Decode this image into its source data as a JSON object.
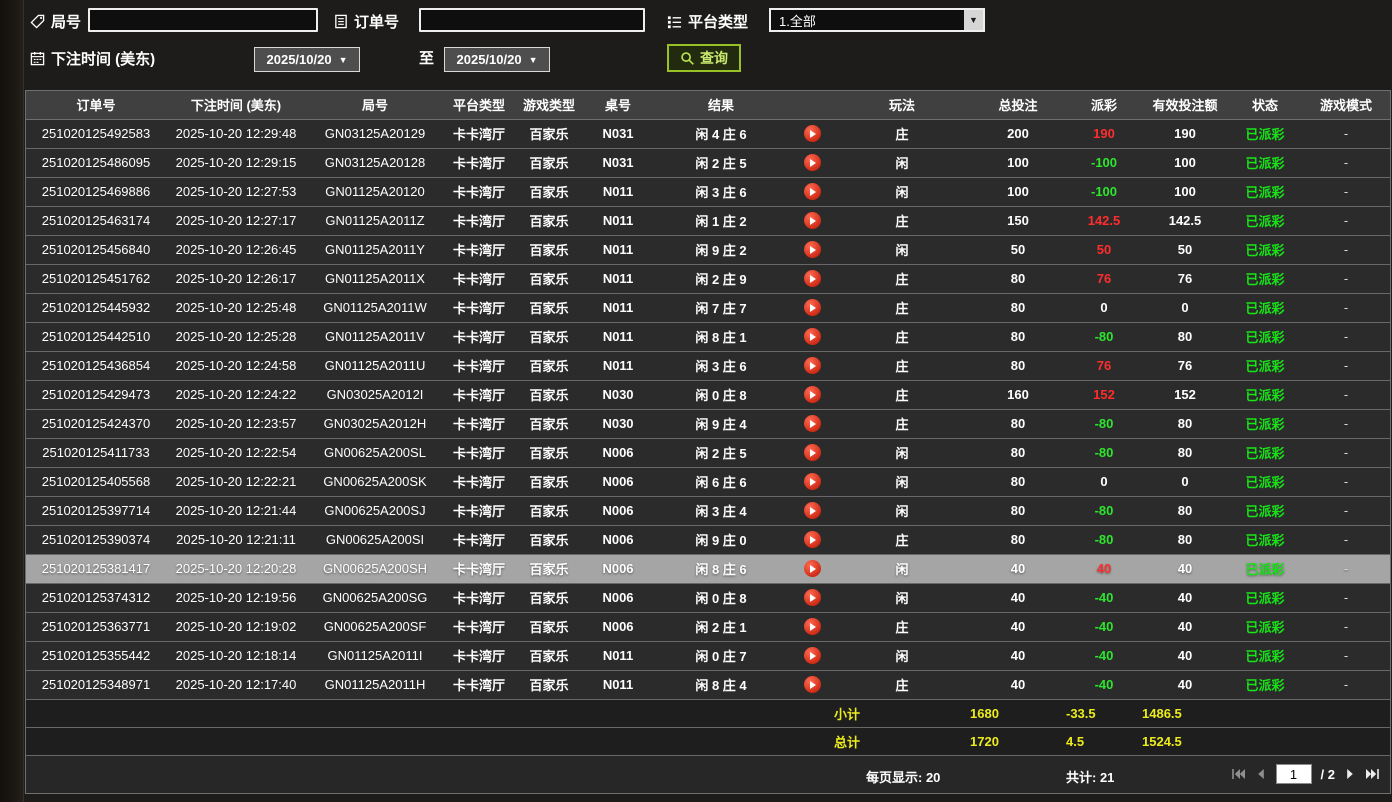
{
  "filters": {
    "round_label": "局号",
    "round_value": "",
    "order_label": "订单号",
    "order_value": "",
    "platform_label": "平台类型",
    "platform_value": "1.全部",
    "bet_time_label": "下注时间 (美东)",
    "date_from": "2025/10/20",
    "to_label": "至",
    "date_to": "2025/10/20",
    "query_label": "查询"
  },
  "colors": {
    "payout_positive": "#ff2d2d",
    "payout_negative": "#2ee52e",
    "status_green": "#17e317",
    "query_green": "#96c225",
    "footer_yellow": "#ecec1d"
  },
  "table": {
    "headers": [
      "订单号",
      "下注时间 (美东)",
      "局号",
      "平台类型",
      "游戏类型",
      "桌号",
      "结果",
      "",
      "玩法",
      "总投注",
      "派彩",
      "有效投注额",
      "状态",
      "游戏模式"
    ],
    "rows": [
      {
        "order_id": "251020125492583",
        "time": "2025-10-20 12:29:48",
        "round": "GN03125A20129",
        "platform": "卡卡湾厅",
        "game": "百家乐",
        "table_no": "N031",
        "result": "闲 4 庄 6",
        "play": "庄",
        "total_bet": "200",
        "payout": "190",
        "payout_sign": "pos",
        "valid_bet": "190",
        "status": "已派彩",
        "mode": "-",
        "selected": false
      },
      {
        "order_id": "251020125486095",
        "time": "2025-10-20 12:29:15",
        "round": "GN03125A20128",
        "platform": "卡卡湾厅",
        "game": "百家乐",
        "table_no": "N031",
        "result": "闲 2 庄 5",
        "play": "闲",
        "total_bet": "100",
        "payout": "-100",
        "payout_sign": "neg",
        "valid_bet": "100",
        "status": "已派彩",
        "mode": "-",
        "selected": false
      },
      {
        "order_id": "251020125469886",
        "time": "2025-10-20 12:27:53",
        "round": "GN01125A20120",
        "platform": "卡卡湾厅",
        "game": "百家乐",
        "table_no": "N011",
        "result": "闲 3 庄 6",
        "play": "闲",
        "total_bet": "100",
        "payout": "-100",
        "payout_sign": "neg",
        "valid_bet": "100",
        "status": "已派彩",
        "mode": "-",
        "selected": false
      },
      {
        "order_id": "251020125463174",
        "time": "2025-10-20 12:27:17",
        "round": "GN01125A2011Z",
        "platform": "卡卡湾厅",
        "game": "百家乐",
        "table_no": "N011",
        "result": "闲 1 庄 2",
        "play": "庄",
        "total_bet": "150",
        "payout": "142.5",
        "payout_sign": "pos",
        "valid_bet": "142.5",
        "status": "已派彩",
        "mode": "-",
        "selected": false
      },
      {
        "order_id": "251020125456840",
        "time": "2025-10-20 12:26:45",
        "round": "GN01125A2011Y",
        "platform": "卡卡湾厅",
        "game": "百家乐",
        "table_no": "N011",
        "result": "闲 9 庄 2",
        "play": "闲",
        "total_bet": "50",
        "payout": "50",
        "payout_sign": "pos",
        "valid_bet": "50",
        "status": "已派彩",
        "mode": "-",
        "selected": false
      },
      {
        "order_id": "251020125451762",
        "time": "2025-10-20 12:26:17",
        "round": "GN01125A2011X",
        "platform": "卡卡湾厅",
        "game": "百家乐",
        "table_no": "N011",
        "result": "闲 2 庄 9",
        "play": "庄",
        "total_bet": "80",
        "payout": "76",
        "payout_sign": "pos",
        "valid_bet": "76",
        "status": "已派彩",
        "mode": "-",
        "selected": false
      },
      {
        "order_id": "251020125445932",
        "time": "2025-10-20 12:25:48",
        "round": "GN01125A2011W",
        "platform": "卡卡湾厅",
        "game": "百家乐",
        "table_no": "N011",
        "result": "闲 7 庄 7",
        "play": "庄",
        "total_bet": "80",
        "payout": "0",
        "payout_sign": "zero",
        "valid_bet": "0",
        "status": "已派彩",
        "mode": "-",
        "selected": false
      },
      {
        "order_id": "251020125442510",
        "time": "2025-10-20 12:25:28",
        "round": "GN01125A2011V",
        "platform": "卡卡湾厅",
        "game": "百家乐",
        "table_no": "N011",
        "result": "闲 8 庄 1",
        "play": "庄",
        "total_bet": "80",
        "payout": "-80",
        "payout_sign": "neg",
        "valid_bet": "80",
        "status": "已派彩",
        "mode": "-",
        "selected": false
      },
      {
        "order_id": "251020125436854",
        "time": "2025-10-20 12:24:58",
        "round": "GN01125A2011U",
        "platform": "卡卡湾厅",
        "game": "百家乐",
        "table_no": "N011",
        "result": "闲 3 庄 6",
        "play": "庄",
        "total_bet": "80",
        "payout": "76",
        "payout_sign": "pos",
        "valid_bet": "76",
        "status": "已派彩",
        "mode": "-",
        "selected": false
      },
      {
        "order_id": "251020125429473",
        "time": "2025-10-20 12:24:22",
        "round": "GN03025A2012I",
        "platform": "卡卡湾厅",
        "game": "百家乐",
        "table_no": "N030",
        "result": "闲 0 庄 8",
        "play": "庄",
        "total_bet": "160",
        "payout": "152",
        "payout_sign": "pos",
        "valid_bet": "152",
        "status": "已派彩",
        "mode": "-",
        "selected": false
      },
      {
        "order_id": "251020125424370",
        "time": "2025-10-20 12:23:57",
        "round": "GN03025A2012H",
        "platform": "卡卡湾厅",
        "game": "百家乐",
        "table_no": "N030",
        "result": "闲 9 庄 4",
        "play": "庄",
        "total_bet": "80",
        "payout": "-80",
        "payout_sign": "neg",
        "valid_bet": "80",
        "status": "已派彩",
        "mode": "-",
        "selected": false
      },
      {
        "order_id": "251020125411733",
        "time": "2025-10-20 12:22:54",
        "round": "GN00625A200SL",
        "platform": "卡卡湾厅",
        "game": "百家乐",
        "table_no": "N006",
        "result": "闲 2 庄 5",
        "play": "闲",
        "total_bet": "80",
        "payout": "-80",
        "payout_sign": "neg",
        "valid_bet": "80",
        "status": "已派彩",
        "mode": "-",
        "selected": false
      },
      {
        "order_id": "251020125405568",
        "time": "2025-10-20 12:22:21",
        "round": "GN00625A200SK",
        "platform": "卡卡湾厅",
        "game": "百家乐",
        "table_no": "N006",
        "result": "闲 6 庄 6",
        "play": "闲",
        "total_bet": "80",
        "payout": "0",
        "payout_sign": "zero",
        "valid_bet": "0",
        "status": "已派彩",
        "mode": "-",
        "selected": false
      },
      {
        "order_id": "251020125397714",
        "time": "2025-10-20 12:21:44",
        "round": "GN00625A200SJ",
        "platform": "卡卡湾厅",
        "game": "百家乐",
        "table_no": "N006",
        "result": "闲 3 庄 4",
        "play": "闲",
        "total_bet": "80",
        "payout": "-80",
        "payout_sign": "neg",
        "valid_bet": "80",
        "status": "已派彩",
        "mode": "-",
        "selected": false
      },
      {
        "order_id": "251020125390374",
        "time": "2025-10-20 12:21:11",
        "round": "GN00625A200SI",
        "platform": "卡卡湾厅",
        "game": "百家乐",
        "table_no": "N006",
        "result": "闲 9 庄 0",
        "play": "庄",
        "total_bet": "80",
        "payout": "-80",
        "payout_sign": "neg",
        "valid_bet": "80",
        "status": "已派彩",
        "mode": "-",
        "selected": false
      },
      {
        "order_id": "251020125381417",
        "time": "2025-10-20 12:20:28",
        "round": "GN00625A200SH",
        "platform": "卡卡湾厅",
        "game": "百家乐",
        "table_no": "N006",
        "result": "闲 8 庄 6",
        "play": "闲",
        "total_bet": "40",
        "payout": "40",
        "payout_sign": "pos",
        "valid_bet": "40",
        "status": "已派彩",
        "mode": "-",
        "selected": true
      },
      {
        "order_id": "251020125374312",
        "time": "2025-10-20 12:19:56",
        "round": "GN00625A200SG",
        "platform": "卡卡湾厅",
        "game": "百家乐",
        "table_no": "N006",
        "result": "闲 0 庄 8",
        "play": "闲",
        "total_bet": "40",
        "payout": "-40",
        "payout_sign": "neg",
        "valid_bet": "40",
        "status": "已派彩",
        "mode": "-",
        "selected": false
      },
      {
        "order_id": "251020125363771",
        "time": "2025-10-20 12:19:02",
        "round": "GN00625A200SF",
        "platform": "卡卡湾厅",
        "game": "百家乐",
        "table_no": "N006",
        "result": "闲 2 庄 1",
        "play": "庄",
        "total_bet": "40",
        "payout": "-40",
        "payout_sign": "neg",
        "valid_bet": "40",
        "status": "已派彩",
        "mode": "-",
        "selected": false
      },
      {
        "order_id": "251020125355442",
        "time": "2025-10-20 12:18:14",
        "round": "GN01125A2011I",
        "platform": "卡卡湾厅",
        "game": "百家乐",
        "table_no": "N011",
        "result": "闲 0 庄 7",
        "play": "闲",
        "total_bet": "40",
        "payout": "-40",
        "payout_sign": "neg",
        "valid_bet": "40",
        "status": "已派彩",
        "mode": "-",
        "selected": false
      },
      {
        "order_id": "251020125348971",
        "time": "2025-10-20 12:17:40",
        "round": "GN01125A2011H",
        "platform": "卡卡湾厅",
        "game": "百家乐",
        "table_no": "N011",
        "result": "闲 8 庄 4",
        "play": "庄",
        "total_bet": "40",
        "payout": "-40",
        "payout_sign": "neg",
        "valid_bet": "40",
        "status": "已派彩",
        "mode": "-",
        "selected": false
      }
    ],
    "subtotal": {
      "label": "小计",
      "total_bet": "1680",
      "payout": "-33.5",
      "valid_bet": "1486.5"
    },
    "grand_total": {
      "label": "总计",
      "total_bet": "1720",
      "payout": "4.5",
      "valid_bet": "1524.5"
    }
  },
  "pagination": {
    "per_page": "每页显示: 20",
    "total": "共计: 21",
    "page": "1",
    "of": "/ 2"
  }
}
